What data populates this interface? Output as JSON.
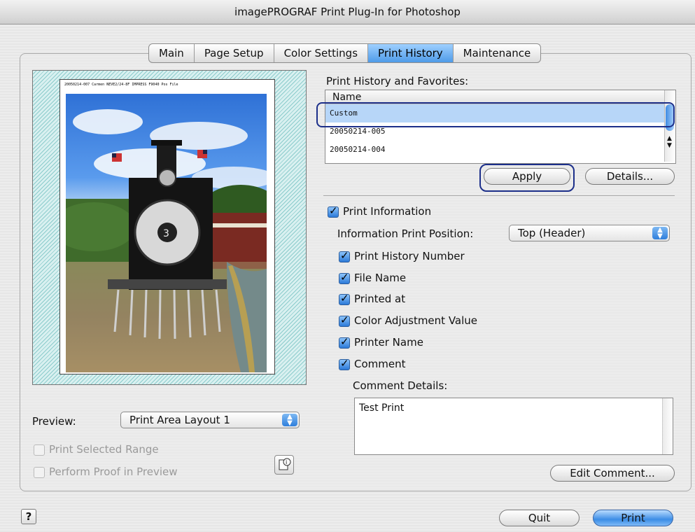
{
  "window": {
    "title": "imagePROGRAF Print Plug-In for Photoshop"
  },
  "tabs": [
    {
      "label": "Main"
    },
    {
      "label": "Page Setup"
    },
    {
      "label": "Color Settings"
    },
    {
      "label": "Print History"
    },
    {
      "label": "Maintenance"
    }
  ],
  "active_tab": "Print History",
  "preview": {
    "header_text": "20050214-007  Carmen  NEVE2/24-8F  IMPRESS  F9040 Pos  File",
    "label": "Preview:",
    "layout_value": "Print Area Layout 1",
    "print_selected_range": "Print Selected Range",
    "perform_proof": "Perform Proof in Preview"
  },
  "history": {
    "title": "Print History and Favorites:",
    "column_name": "Name",
    "items": [
      "Custom",
      "20050214-005",
      "20050214-004"
    ],
    "selected": "Custom",
    "apply_label": "Apply",
    "details_label": "Details..."
  },
  "print_info": {
    "label": "Print Information",
    "position_label": "Information Print Position:",
    "position_value": "Top (Header)",
    "options": [
      {
        "label": "Print History Number",
        "checked": true
      },
      {
        "label": "File Name",
        "checked": true
      },
      {
        "label": "Printed at",
        "checked": true
      },
      {
        "label": "Color Adjustment Value",
        "checked": true
      },
      {
        "label": "Printer Name",
        "checked": true
      },
      {
        "label": "Comment",
        "checked": true
      }
    ],
    "comment_details_label": "Comment Details:",
    "comment_text": "Test Print",
    "edit_comment_label": "Edit Comment..."
  },
  "footer": {
    "help_glyph": "?",
    "quit_label": "Quit",
    "print_label": "Print"
  },
  "icons": {
    "help": "help-icon",
    "proof_info": "proof-info-icon",
    "checkbox": "checkmark-icon"
  }
}
